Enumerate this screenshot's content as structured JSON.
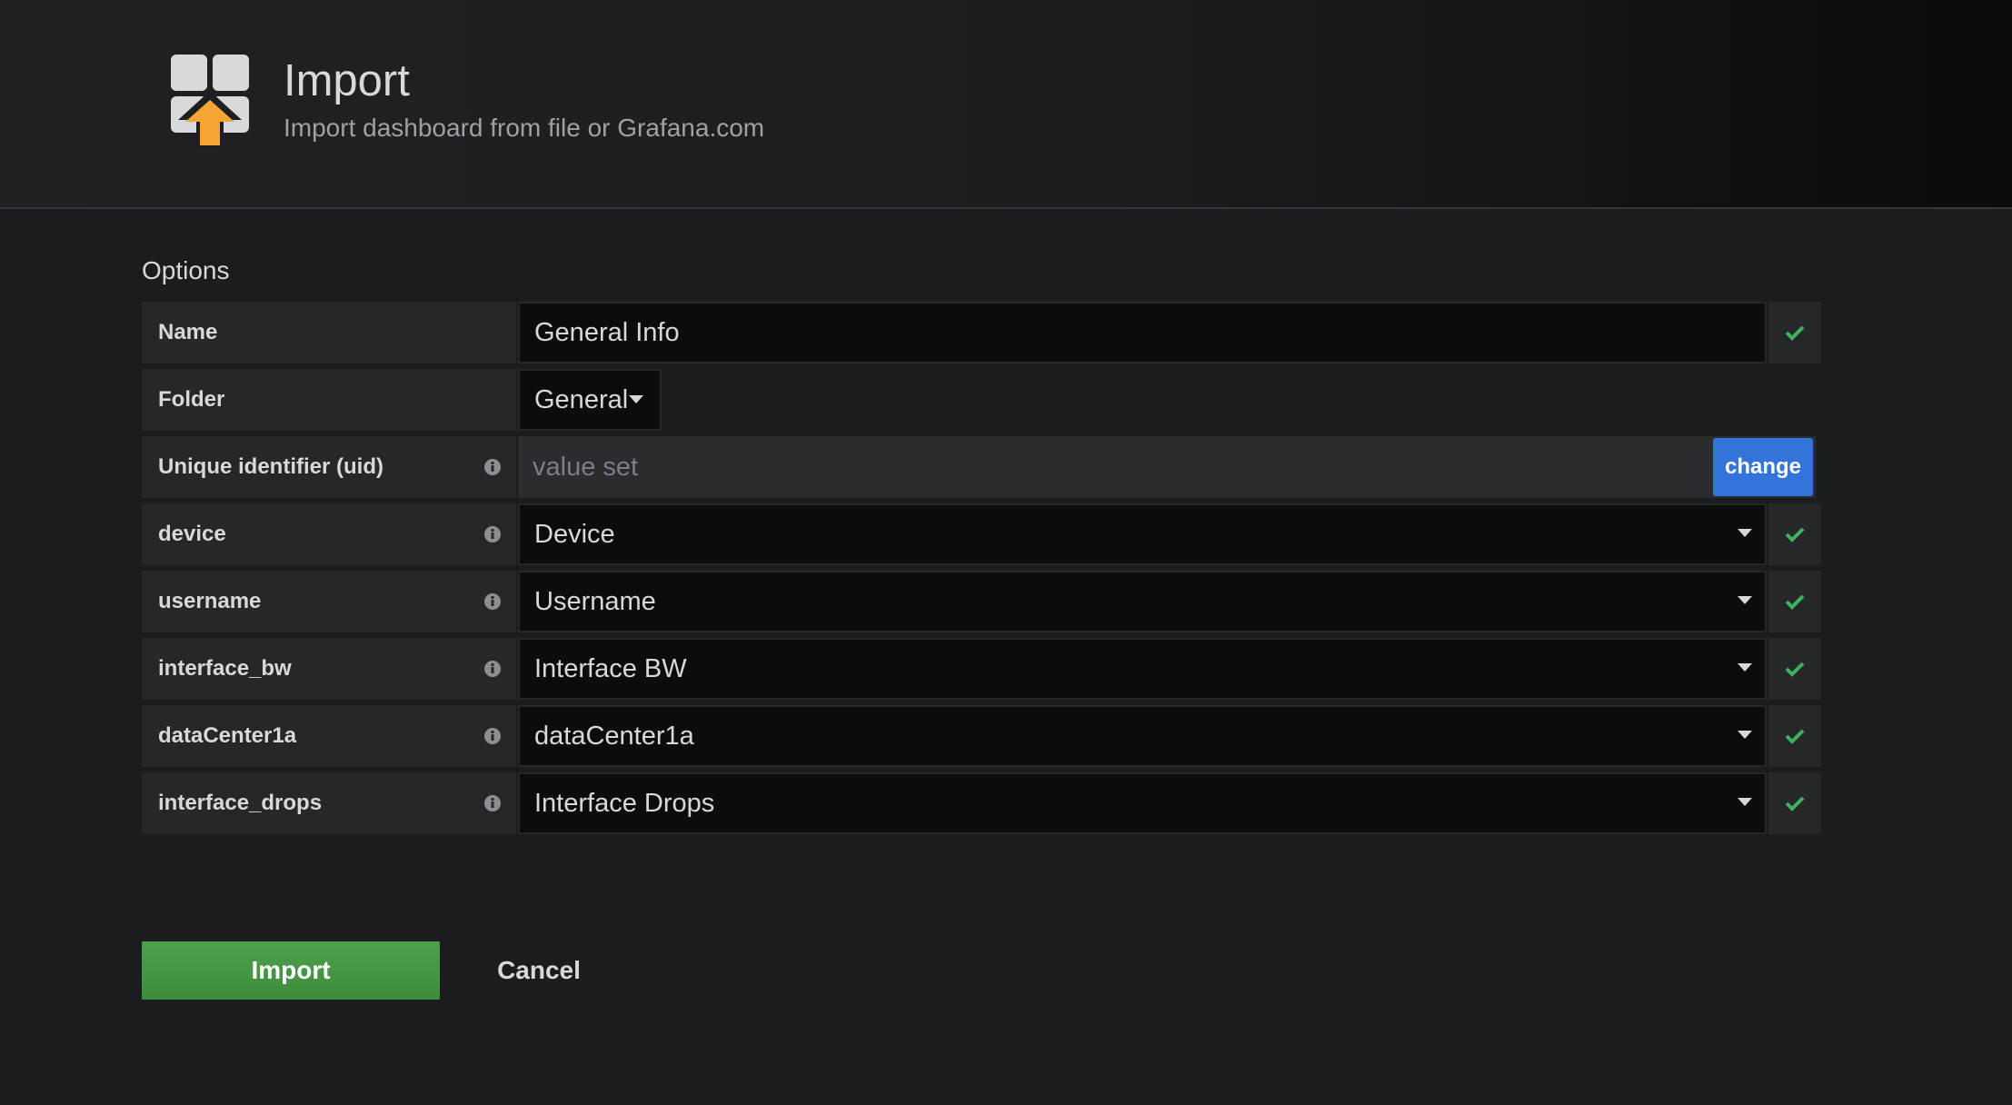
{
  "header": {
    "title": "Import",
    "subtitle": "Import dashboard from file or Grafana.com",
    "icon": "import-icon"
  },
  "options": {
    "title": "Options",
    "name": {
      "label": "Name",
      "value": "General Info",
      "valid": true
    },
    "folder": {
      "label": "Folder",
      "value": "General"
    },
    "uid": {
      "label": "Unique identifier (uid)",
      "value": "value set",
      "button": "change"
    },
    "inputs": [
      {
        "label": "device",
        "value": "Device",
        "valid": true
      },
      {
        "label": "username",
        "value": "Username",
        "valid": true
      },
      {
        "label": "interface_bw",
        "value": "Interface BW",
        "valid": true
      },
      {
        "label": "dataCenter1a",
        "value": "dataCenter1a",
        "valid": true
      },
      {
        "label": "interface_drops",
        "value": "Interface Drops",
        "valid": true
      }
    ]
  },
  "actions": {
    "import_label": "Import",
    "cancel_label": "Cancel"
  },
  "colors": {
    "accent_blue": "#3274d9",
    "success_green": "#3f9b3f",
    "check_green": "#3eb15b"
  }
}
